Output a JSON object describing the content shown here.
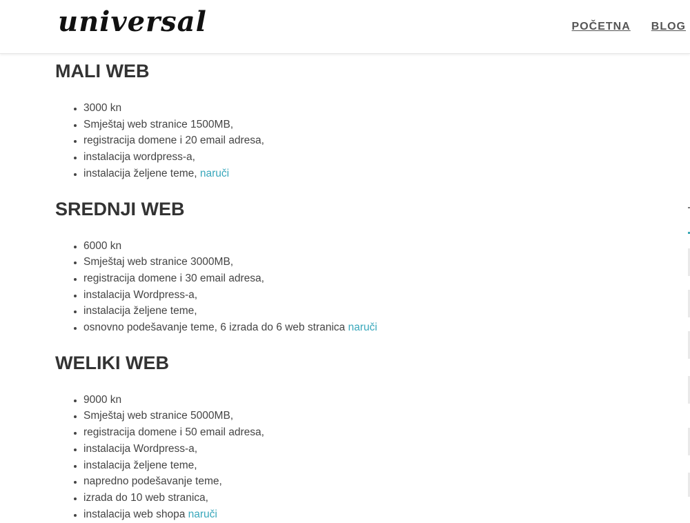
{
  "header": {
    "logo": "universal",
    "nav": [
      {
        "label": "POČETNA"
      },
      {
        "label": "BLOG"
      }
    ]
  },
  "packages": [
    {
      "title": "MALI WEB",
      "items": [
        "3000 kn",
        "Smještaj web stranice 1500MB,",
        "registracija domene i 20 email adresa,",
        "instalacija wordpress-a,",
        "instalacija željene teme,"
      ],
      "order_link": "naruči"
    },
    {
      "title": "SREDNJI WEB",
      "items": [
        "6000 kn",
        "Smještaj web stranice 3000MB,",
        "registracija domene i 30 email adresa,",
        "instalacija Wordpress-a,",
        "instalacija željene teme,",
        "osnovno podešavanje teme, 6 izrada do 6 web stranica"
      ],
      "order_link": "naruči"
    },
    {
      "title": "WELIKI WEB",
      "items": [
        "9000 kn",
        "Smještaj web stranice 5000MB,",
        "registracija domene i 50 email adresa,",
        "instalacija Wordpress-a,",
        "instalacija željene teme,",
        "napredno podešavanje teme,",
        "izrada do 10 web stranica,",
        "instalacija web shopa"
      ],
      "order_link": "naruči"
    }
  ],
  "colors": {
    "link": "#38a7bb",
    "heading": "#333333",
    "text": "#444444"
  }
}
